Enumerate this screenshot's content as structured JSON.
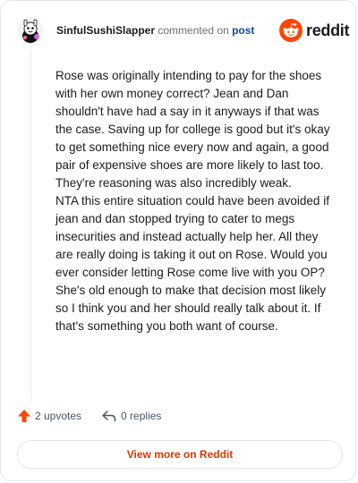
{
  "header": {
    "username": "SinfulSushiSlapper",
    "action_text": "commented on",
    "post_link": "post",
    "logo_text": "reddit"
  },
  "comment": {
    "paragraphs": [
      "Rose was originally intending to pay for the shoes with her own money correct? Jean and Dan shouldn't have had a say in it anyways if that was the case. Saving up for college is good but it's okay to get something nice every now and again, a good pair of expensive shoes are more likely to last too. They're reasoning was also incredibly weak.",
      "NTA this entire situation could have been avoided if jean and dan stopped trying to cater to megs insecurities and instead actually help her. All they are really doing is taking it out on Rose. Would you ever consider letting Rose come live with you OP? She's old enough to make that decision most likely so I think you and her should really talk about it. If that's something you both want of course."
    ]
  },
  "actions": {
    "upvotes": "2 upvotes",
    "replies": "0 replies"
  },
  "footer": {
    "view_more": "View more on Reddit"
  },
  "colors": {
    "brand": "#ff4500",
    "upvote": "#ff4500",
    "link": "#0b4f9c",
    "view_more": "#d93a00"
  },
  "icons": {
    "avatar": "cartoon-avatar",
    "logo": "reddit-snoo-icon",
    "upvote": "upvote-arrow-icon",
    "reply": "reply-arrow-icon"
  }
}
